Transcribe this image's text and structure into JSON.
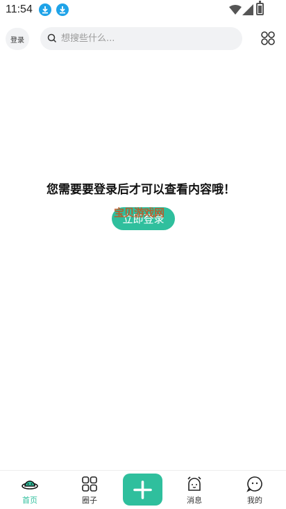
{
  "status_bar": {
    "time": "11:54"
  },
  "header": {
    "login_label": "登录",
    "search": {
      "placeholder": "想搜些什么..."
    }
  },
  "main": {
    "message": "您需要要登录后才可以查看内容哦！",
    "login_button": "立即登录",
    "watermark": "宝贝游戏网"
  },
  "bottom_nav": {
    "items": [
      {
        "label": "首页",
        "icon": "planet-icon",
        "active": true
      },
      {
        "label": "圈子",
        "icon": "grid-icon",
        "active": false
      },
      {
        "label": "消息",
        "icon": "alarm-bell-icon",
        "active": false
      },
      {
        "label": "我的",
        "icon": "chat-bubble-icon",
        "active": false
      }
    ],
    "post_icon": "plus-icon"
  },
  "colors": {
    "accent": "#2fbf9d",
    "download_badge": "#1fa3e8",
    "search_bg": "#f1f2f4"
  }
}
